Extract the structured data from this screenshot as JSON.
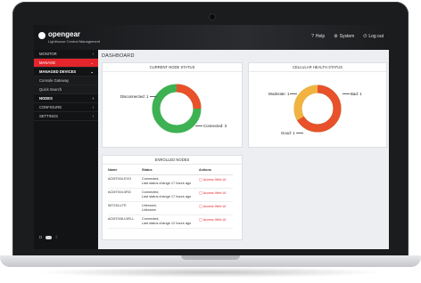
{
  "app": {
    "logo_name": "opengear",
    "logo_sub": "Lighthouse Central Management"
  },
  "topnav": [
    {
      "icon": "help-icon",
      "glyph": "?",
      "label": "Help"
    },
    {
      "icon": "system-icon",
      "glyph": "⚙",
      "label": "System"
    },
    {
      "icon": "logout-icon",
      "glyph": "⏻",
      "label": "Log out"
    }
  ],
  "sidebar": {
    "monitor": "MONITOR",
    "manage": "MANAGE",
    "managed_devices": "MANAGED DEVICES",
    "console_gateway": "Console Gateway",
    "quick_search": "Quick Search",
    "nodes": "NODES",
    "configure": "CONFIGURE",
    "settings": "SETTINGS"
  },
  "page_title": "DASHBOARD",
  "node_status": {
    "title": "CURRENT NODE STATUS",
    "disconnected_label": "Disconnected: 1",
    "connected_label": "Connected: 3",
    "colors": {
      "connected": "#3eb152",
      "disconnected": "#e8512a"
    }
  },
  "cellular": {
    "title": "CELLULAR HEALTH STATUS",
    "moderate_label": "Moderate: 1",
    "bad_label": "Bad: 1",
    "good_label": "Good: 1",
    "colors": {
      "moderate": "#f2b340",
      "bad": "#e8512a",
      "good": "#3eb152"
    }
  },
  "enrolled": {
    "title": "ENROLLED NODES",
    "headers": {
      "name": "Name",
      "status": "Status",
      "actions": "Actions"
    },
    "rows": [
      {
        "name": "ACM7004-EVO",
        "status1": "Connected,",
        "status2": "Last status change 17 hours ago",
        "action": "Access Web UI"
      },
      {
        "name": "ACM7004-5RG",
        "status1": "Connected,",
        "status2": "Last status change 17 hours ago",
        "action": "Access Web UI"
      },
      {
        "name": "IM7216-LTE",
        "status1": "Unknown,",
        "status2": "Unknown",
        "action": "Access Web UI"
      },
      {
        "name": "ACM7008-LMS-L",
        "status1": "Connected,",
        "status2": "Last status change 12 hours ago",
        "action": "Access Web UI"
      }
    ]
  },
  "accent_color": "#e4252b"
}
